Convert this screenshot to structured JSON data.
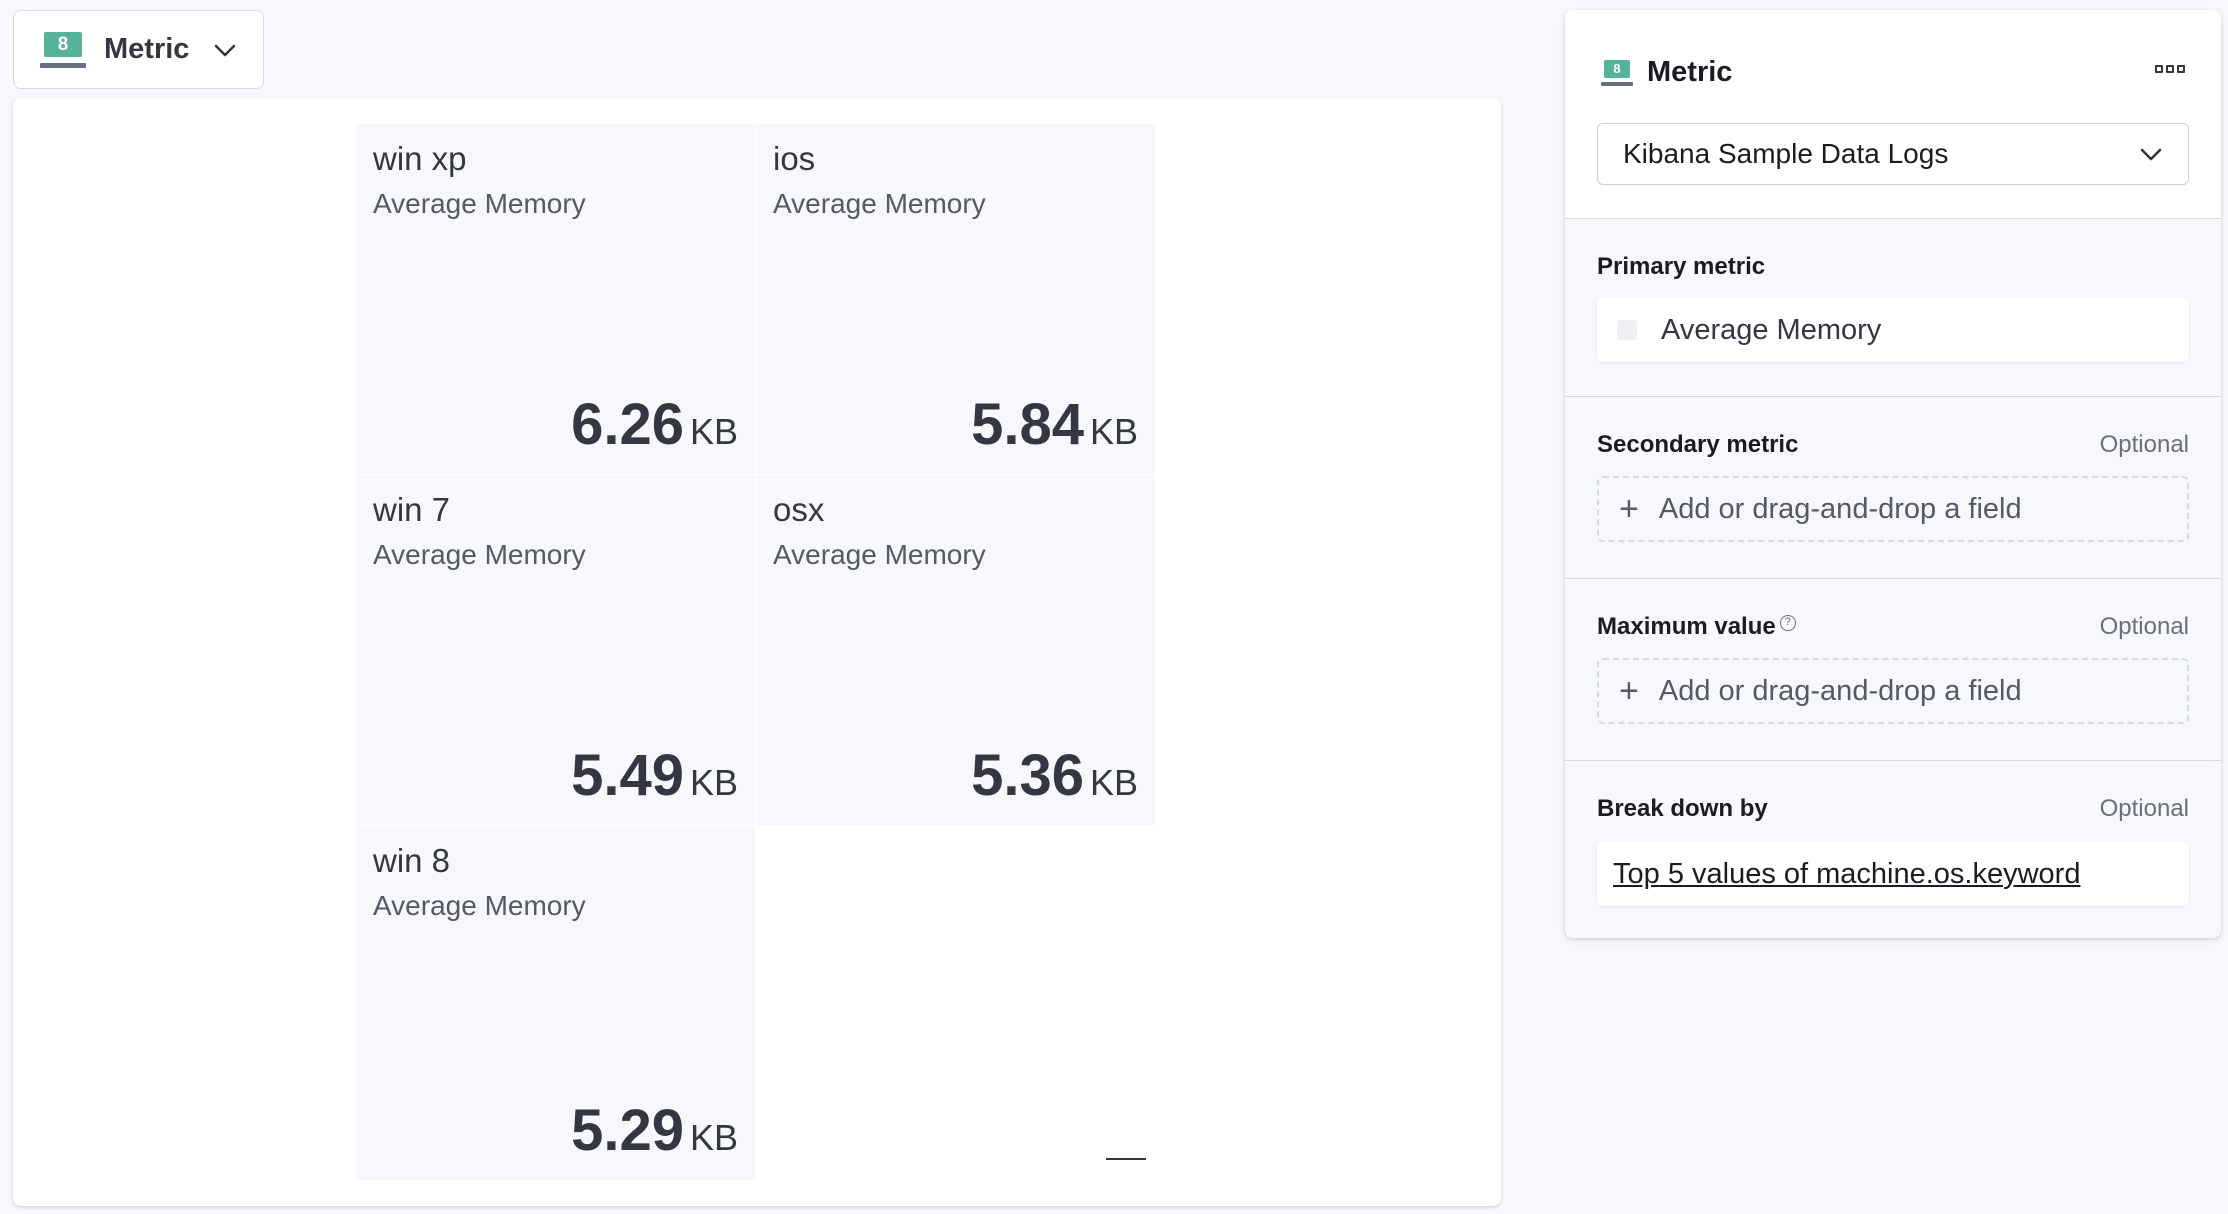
{
  "switcher": {
    "label": "Metric",
    "icon_number": "8"
  },
  "tiles": [
    {
      "title": "win xp",
      "subtitle": "Average Memory",
      "value": "6.26",
      "unit": "KB"
    },
    {
      "title": "ios",
      "subtitle": "Average Memory",
      "value": "5.84",
      "unit": "KB"
    },
    {
      "title": "win 7",
      "subtitle": "Average Memory",
      "value": "5.49",
      "unit": "KB"
    },
    {
      "title": "osx",
      "subtitle": "Average Memory",
      "value": "5.36",
      "unit": "KB"
    },
    {
      "title": "win 8",
      "subtitle": "Average Memory",
      "value": "5.29",
      "unit": "KB"
    }
  ],
  "config": {
    "title": "Metric",
    "icon_number": "8",
    "data_view": "Kibana Sample Data Logs",
    "primary": {
      "label": "Primary metric",
      "field": "Average Memory"
    },
    "secondary": {
      "label": "Secondary metric",
      "optional": "Optional",
      "placeholder": "Add or drag-and-drop a field"
    },
    "maximum": {
      "label": "Maximum value",
      "optional": "Optional",
      "placeholder": "Add or drag-and-drop a field"
    },
    "breakdown": {
      "label": "Break down by",
      "optional": "Optional",
      "field": "Top 5 values of machine.os.keyword"
    }
  },
  "colors": {
    "accent": "#54b399",
    "text": "#343741",
    "panel_bg": "#f7f8fc"
  }
}
